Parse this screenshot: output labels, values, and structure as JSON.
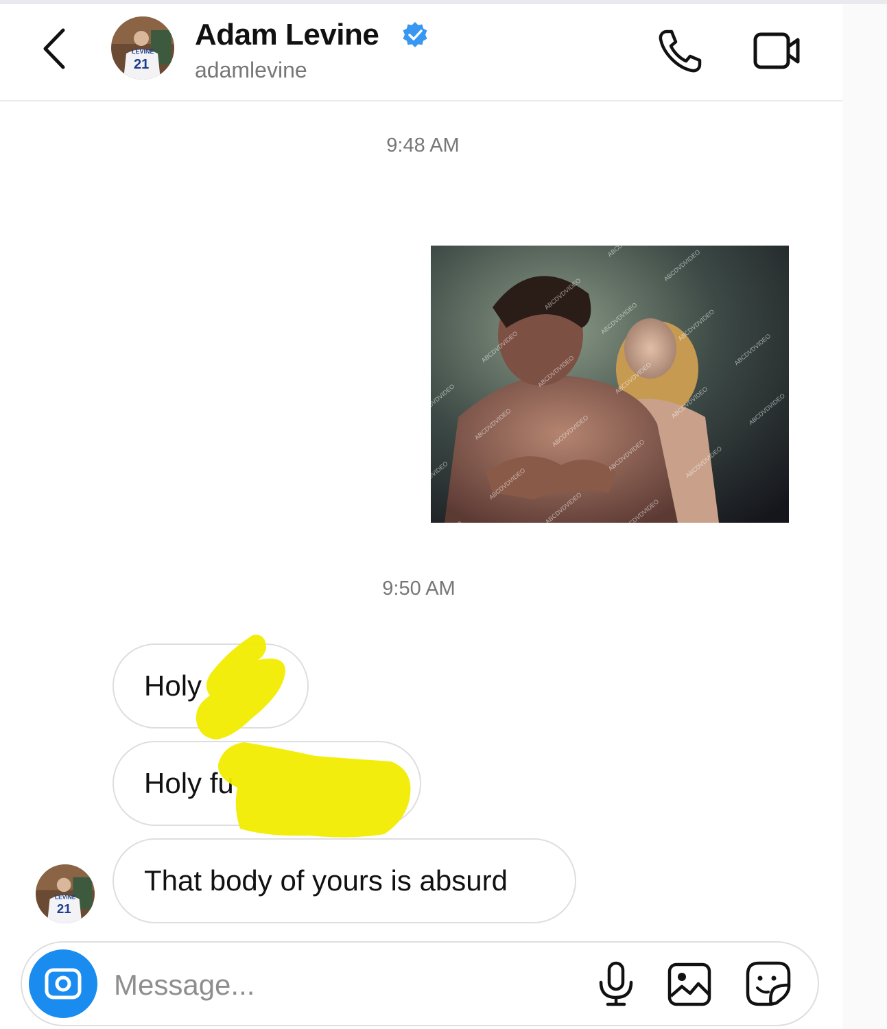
{
  "header": {
    "back_icon": "chevron-left-icon",
    "name": "Adam Levine",
    "verified_icon": "verified-badge-icon",
    "verified_color": "#3897f0",
    "username": "adamlevine",
    "call_icon": "phone-icon",
    "video_icon": "video-camera-icon"
  },
  "conversation": {
    "timestamps": [
      "9:48 AM",
      "9:50 AM"
    ],
    "photo_watermark": "ABCDVDVIDEO",
    "messages": [
      {
        "text": "Holy",
        "redacted": true
      },
      {
        "text": "Holy fu",
        "redacted": true
      },
      {
        "text": "That body of yours is absurd",
        "redacted": false
      }
    ],
    "redaction_color": "#f2ec00"
  },
  "composer": {
    "camera_icon": "camera-icon",
    "camera_color": "#1a8cf0",
    "placeholder": "Message...",
    "mic_icon": "microphone-icon",
    "gallery_icon": "gallery-icon",
    "sticker_icon": "sticker-icon"
  }
}
